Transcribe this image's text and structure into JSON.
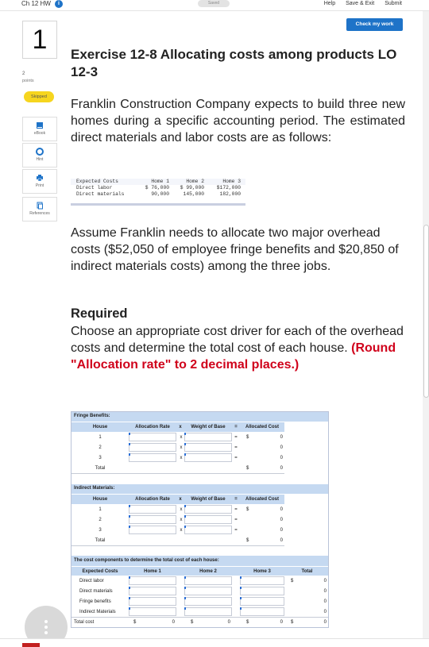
{
  "topbar": {
    "assignment_title": "Ch 12 HW",
    "info_glyph": "i",
    "saved_label": "Saved",
    "help_label": "Help",
    "save_exit_label": "Save & Exit",
    "submit_label": "Submit"
  },
  "check_button_label": "Check my work",
  "question": {
    "number": "1",
    "points_value": "2",
    "points_label": "points",
    "status_badge": "Skipped"
  },
  "tools": [
    {
      "label": "eBook",
      "icon": "book-icon"
    },
    {
      "label": "Hint",
      "icon": "lifebuoy-icon"
    },
    {
      "label": "Print",
      "icon": "printer-icon"
    },
    {
      "label": "References",
      "icon": "copy-icon"
    }
  ],
  "exercise": {
    "title": "Exercise 12-8 Allocating costs among products LO 12-3",
    "intro": "Franklin Construction Company expects to build three new homes during a specific accounting period. The estimated direct materials and labor costs are as follows:",
    "assume": "Assume Franklin needs to allocate two major overhead costs ($52,050 of employee fringe benefits and $20,850 of indirect materials costs) among the three jobs.",
    "required_heading": "Required",
    "required_text": "Choose an appropriate cost driver for each of the overhead costs and determine the total cost of each house.",
    "required_note": "(Round \"Allocation rate\" to 2 decimal places.)"
  },
  "cost_table": {
    "header": [
      "Expected Costs",
      "Home 1",
      "Home 2",
      "Home 3"
    ],
    "rows": [
      [
        "Direct labor",
        "$ 76,000",
        "$ 99,000",
        "$172,000"
      ],
      [
        "Direct materials",
        "90,000",
        "145,000",
        "182,000"
      ]
    ]
  },
  "worksheet": {
    "fringe": {
      "section_title": "Fringe Benefits:",
      "col_house": "House",
      "col_rate": "Allocation Rate",
      "col_x": "x",
      "col_weight": "Weight of Base",
      "col_eq": "=",
      "col_alloc": "Allocated Cost",
      "rows": [
        {
          "house": "1",
          "op_x": "x",
          "op_eq": "=",
          "dollar": "$",
          "value": "0"
        },
        {
          "house": "2",
          "op_x": "x",
          "op_eq": "=",
          "dollar": "",
          "value": "0"
        },
        {
          "house": "3",
          "op_x": "x",
          "op_eq": "=",
          "dollar": "",
          "value": "0"
        }
      ],
      "total_label": "Total",
      "total_dollar": "$",
      "total_value": "0"
    },
    "indirect": {
      "section_title": "Indirect Materials:",
      "col_house": "House",
      "col_rate": "Allocation Rate",
      "col_x": "x",
      "col_weight": "Weight of Base",
      "col_eq": "=",
      "col_alloc": "Allocated Cost",
      "rows": [
        {
          "house": "1",
          "op_x": "x",
          "op_eq": "=",
          "dollar": "$",
          "value": "0"
        },
        {
          "house": "2",
          "op_x": "x",
          "op_eq": "=",
          "dollar": "",
          "value": "0"
        },
        {
          "house": "3",
          "op_x": "x",
          "op_eq": "=",
          "dollar": "",
          "value": "0"
        }
      ],
      "total_label": "Total",
      "total_dollar": "$",
      "total_value": "0"
    },
    "summary": {
      "section_title": "The cost components to determine the total cost of each house:",
      "col_components": "Expected Costs",
      "col_home1": "Home 1",
      "col_home2": "Home 2",
      "col_home3": "Home 3",
      "col_total": "Total",
      "rows": [
        {
          "label": "Direct labor",
          "dollar": "$",
          "total": "0"
        },
        {
          "label": "Direct materials",
          "dollar": "",
          "total": "0"
        },
        {
          "label": "Fringe benefits",
          "dollar": "",
          "total": "0"
        },
        {
          "label": "Indirect Materials",
          "dollar": "",
          "total": "0"
        }
      ],
      "total_row": {
        "label": "Total cost",
        "h1_dollar": "$",
        "h1": "0",
        "h2_dollar": "$",
        "h2": "0",
        "h3_dollar": "$",
        "h3": "0",
        "t_dollar": "$",
        "t": "0"
      }
    }
  },
  "colors": {
    "accent": "#1e73c8",
    "badge_skipped": "#f6d51f",
    "emphasis_red": "#d0021b",
    "worksheet_band": "#c5d9f1"
  }
}
